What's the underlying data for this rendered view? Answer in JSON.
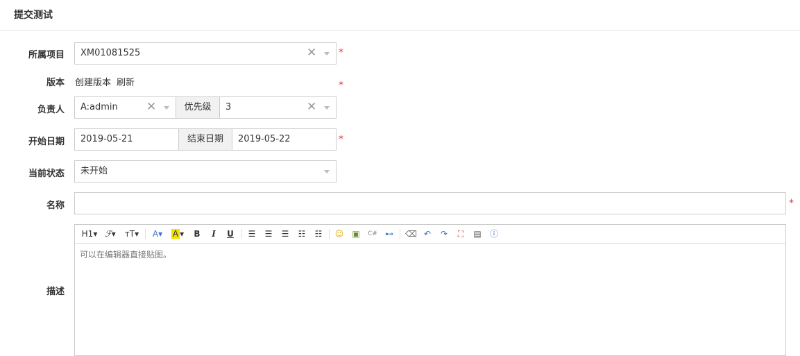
{
  "page": {
    "title": "提交测试"
  },
  "form": {
    "project": {
      "label": "所属项目",
      "value": "XM01081525"
    },
    "version": {
      "label": "版本",
      "create_link": "创建版本",
      "refresh_link": "刷新"
    },
    "owner": {
      "label": "负责人",
      "value": "A:admin",
      "priority_label": "优先级",
      "priority_value": "3"
    },
    "dates": {
      "label": "开始日期",
      "start_value": "2019-05-21",
      "end_label": "结束日期",
      "end_value": "2019-05-22"
    },
    "status": {
      "label": "当前状态",
      "value": "未开始"
    },
    "name": {
      "label": "名称",
      "value": ""
    },
    "description": {
      "label": "描述",
      "placeholder": "可以在编辑器直接贴图。",
      "toolbar": {
        "heading": "H1",
        "font_family": "ℱ",
        "font_size": "тT",
        "font_color": "A",
        "bg_color": "A",
        "bold": "B",
        "italic": "I",
        "underline": "U"
      }
    },
    "required_mark": "*"
  },
  "colors": {
    "required": "#ee3333",
    "border": "#cccccc",
    "addon_bg": "#f1f1f1",
    "icon_blue": "#3b73c2"
  }
}
